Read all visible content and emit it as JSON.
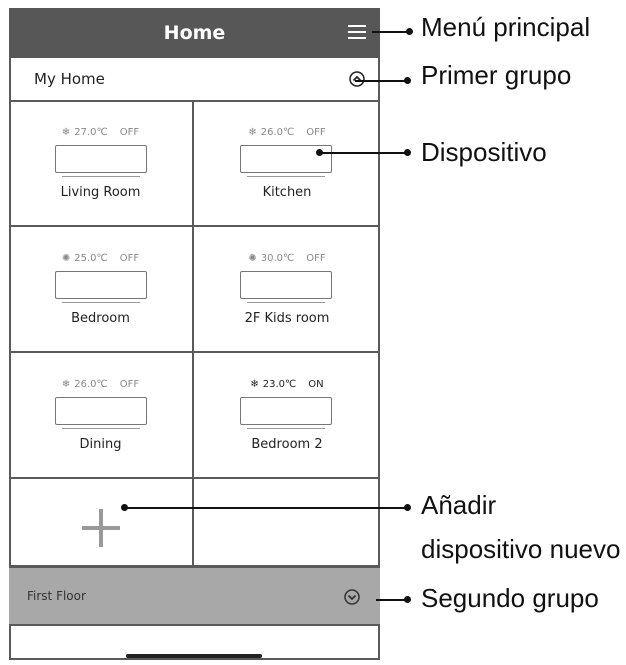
{
  "header": {
    "title": "Home"
  },
  "group_1": {
    "label": "My Home"
  },
  "devices": [
    {
      "temp": "27.0℃",
      "state": "OFF",
      "name": "Living Room"
    },
    {
      "temp": "26.0℃",
      "state": "OFF",
      "name": "Kitchen"
    },
    {
      "temp": "25.0℃",
      "state": "OFF",
      "name": "Bedroom"
    },
    {
      "temp": "30.0℃",
      "state": "OFF",
      "name": "2F Kids room"
    },
    {
      "temp": "26.0℃",
      "state": "OFF",
      "name": "Dining"
    },
    {
      "temp": "23.0℃",
      "state": "ON",
      "name": "Bedroom 2"
    }
  ],
  "group_2": {
    "label": "First Floor"
  },
  "annotations": {
    "main_menu": "Menú principal",
    "first_group": "Primer grupo",
    "device": "Dispositivo",
    "add_device_line1": "Añadir",
    "add_device_line2": "dispositivo nuevo",
    "second_group": "Segundo grupo"
  }
}
